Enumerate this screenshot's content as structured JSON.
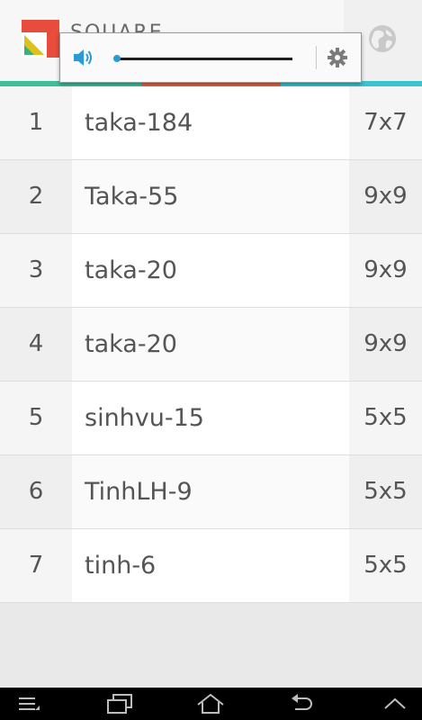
{
  "app": {
    "title": "SQUARE"
  },
  "colors": {
    "stripe": [
      "#3dbf9a",
      "#e0624a",
      "#39c4cf"
    ],
    "logo_red": "#e74c3c",
    "logo_green": "#3bb07d",
    "logo_yellow": "#f1c40f",
    "accent_blue": "#2a9bd6"
  },
  "icons": {
    "globe": "globe-icon",
    "volume": "speaker-icon",
    "settings": "gear-icon"
  },
  "volume": {
    "level": 0.0
  },
  "rows": [
    {
      "rank": "1",
      "name": "taka-184",
      "size": "7x7"
    },
    {
      "rank": "2",
      "name": "Taka-55",
      "size": "9x9"
    },
    {
      "rank": "3",
      "name": "taka-20",
      "size": "9x9"
    },
    {
      "rank": "4",
      "name": "taka-20",
      "size": "9x9"
    },
    {
      "rank": "5",
      "name": "sinhvu-15",
      "size": "5x5"
    },
    {
      "rank": "6",
      "name": "TinhLH-9",
      "size": "5x5"
    },
    {
      "rank": "7",
      "name": "tinh-6",
      "size": "5x5"
    }
  ],
  "navbar": [
    "menu-icon",
    "recent-apps-icon",
    "home-icon",
    "back-icon",
    "up-chevron-icon"
  ]
}
